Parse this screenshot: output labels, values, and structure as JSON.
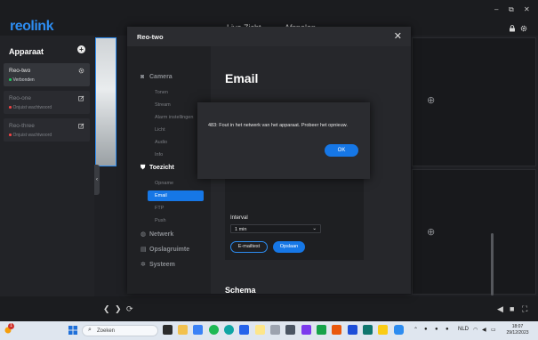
{
  "app": {
    "brand": "reolink",
    "top_nav": {
      "live": "Live Zicht",
      "playback": "Afspelen"
    },
    "window_controls": {
      "minimize": "–",
      "restore": "⧉",
      "close": "✕"
    },
    "colors": {
      "accent": "#1677e6",
      "brand": "#2d8cf0",
      "online": "#22c55e",
      "offline": "#ef4444"
    }
  },
  "sidebar": {
    "title": "Apparaat",
    "add_icon": "+",
    "devices": [
      {
        "name": "Reo-two",
        "status": "Verbonden",
        "state": "online",
        "icon": "gear-icon"
      },
      {
        "name": "Reo-one",
        "status": "Onjuist wachtwoord",
        "state": "offline",
        "icon": "edit-icon"
      },
      {
        "name": "Reo-three",
        "status": "Onjuist wachtwoord",
        "state": "offline",
        "icon": "edit-icon"
      }
    ]
  },
  "settings_dialog": {
    "title": "Reo-two",
    "close_icon": "✕",
    "nav": {
      "camera": {
        "label": "Camera",
        "items": [
          "Tonen",
          "Stream",
          "Alarm instellingen",
          "Licht",
          "Audio",
          "Info"
        ]
      },
      "monitoring": {
        "label": "Toezicht",
        "items": [
          "Opname",
          "Email",
          "FTP",
          "Push"
        ],
        "active_item": "Email"
      },
      "network": {
        "label": "Netwerk"
      },
      "storage": {
        "label": "Opslagruimte"
      },
      "system": {
        "label": "Systeem"
      }
    },
    "main": {
      "heading": "Email",
      "interval_label": "Interval",
      "interval_value": "1 min",
      "test_button": "E-mailtest",
      "save_button": "Opslaan",
      "schedule_heading": "Schema"
    }
  },
  "error_dialog": {
    "message": "483: Fout in het netwerk van het apparaat. Probeer het opnieuw.",
    "ok_button": "OK"
  },
  "taskbar": {
    "search_placeholder": "Zoeken",
    "weather_badge": "1",
    "language": "NLD",
    "time": "18:07",
    "date": "29/12/2023"
  }
}
